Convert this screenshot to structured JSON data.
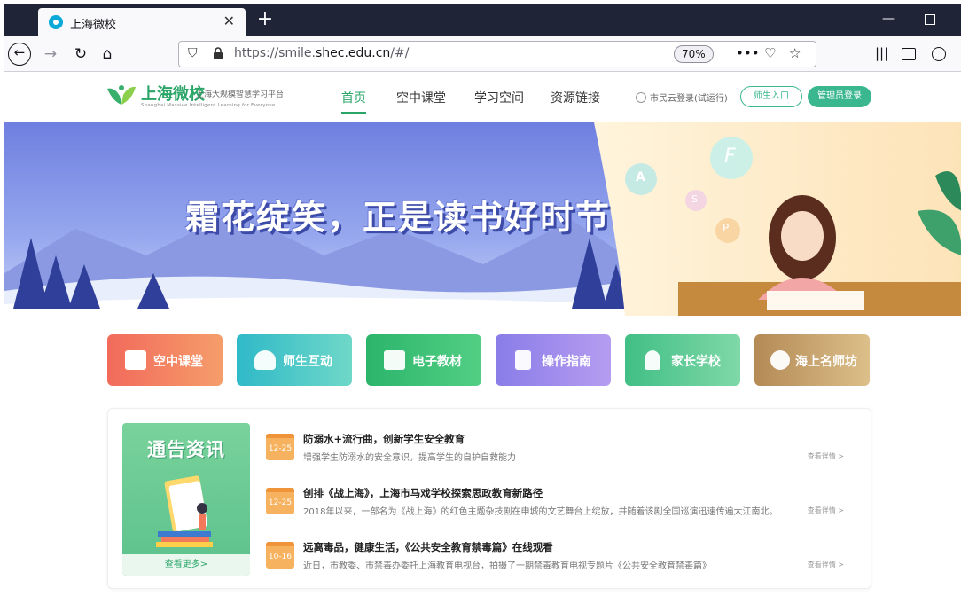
{
  "browser": {
    "tab_title": "上海微校",
    "tab_close": "✕",
    "new_tab": "+",
    "url_prefix": "https://smile.",
    "url_domain": "shec.edu.cn",
    "url_suffix": "/#/",
    "zoom": "70%",
    "more_icon": "•••"
  },
  "site": {
    "logo_text": "上海微校",
    "logo_sub": "上海大规模智慧学习平台",
    "logo_en": "Shanghai Massive Intelligent Learning for Everyone",
    "nav": [
      "首页",
      "空中课堂",
      "学习空间",
      "资源链接"
    ],
    "citizen_login": "市民云登录(试运行)",
    "teacher_entry": "师生入口",
    "admin_login": "管理员登录"
  },
  "banner": {
    "headline": "霜花绽笑，正是读书好时节",
    "letters": [
      "F",
      "A",
      "S",
      "P"
    ]
  },
  "tiles": [
    {
      "label": "空中课堂",
      "color": "#f07a5e"
    },
    {
      "label": "师生互动",
      "color": "#45c3c1"
    },
    {
      "label": "电子教材",
      "color": "#3ac07a"
    },
    {
      "label": "操作指南",
      "color": "#9b87e8"
    },
    {
      "label": "家长学校",
      "color": "#4cc48f"
    },
    {
      "label": "海上名师坊",
      "color": "#c9a46b"
    }
  ],
  "notices": {
    "card_title": "通告资讯",
    "more": "查看更多>",
    "items": [
      {
        "date": "12-25",
        "title": "防溺水+流行曲，创新学生安全教育",
        "summary": "增强学生防溺水的安全意识，提高学生的自护自救能力",
        "detail": "查看详情 >"
      },
      {
        "date": "12-25",
        "title": "创排《战上海》，上海市马戏学校探索思政教育新路径",
        "summary": "2018年以来，一部名为《战上海》的红色主题杂技剧在申城的文艺舞台上绽放，并随着该剧全国巡演迅速传遍大江南北。",
        "detail": "查看详情 >"
      },
      {
        "date": "10-16",
        "title": "远离毒品，健康生活，《公共安全教育禁毒篇》在线观看",
        "summary": "近日，市教委、市禁毒办委托上海教育电视台，拍摄了一期禁毒教育电视专题片《公共安全教育禁毒篇》",
        "detail": "查看详情 >"
      }
    ]
  }
}
